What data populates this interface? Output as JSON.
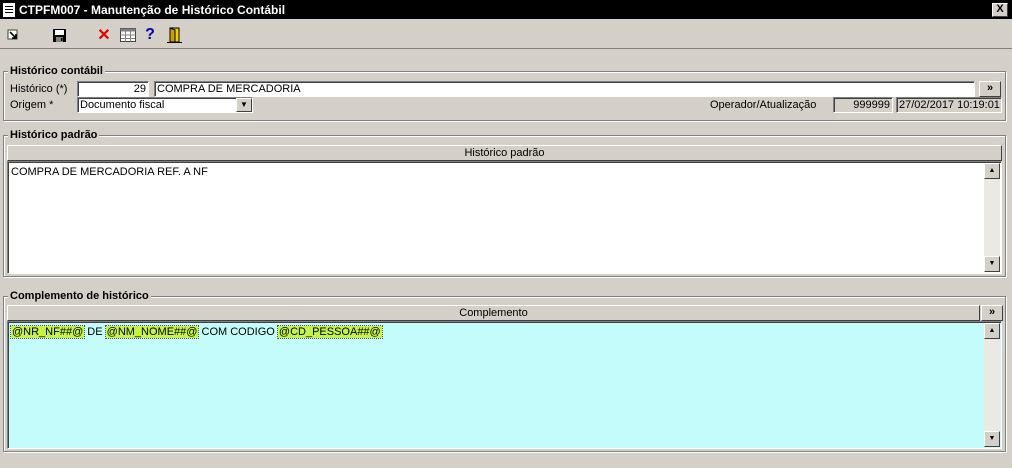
{
  "window": {
    "title": "CTPFM007 - Manutenção de Histórico Contábil",
    "close_label": "X"
  },
  "toolbar": {
    "buttons": [
      {
        "name": "exit-icon"
      },
      {
        "name": "save-icon"
      },
      {
        "name": "delete-icon",
        "glyph": "✕",
        "color": "#e00000"
      },
      {
        "name": "grid-icon"
      },
      {
        "name": "help-icon",
        "glyph": "?",
        "color": "#0000b0"
      },
      {
        "name": "door-icon"
      }
    ]
  },
  "historico_contabil": {
    "title": "Histórico contábil",
    "historico_label": "Histórico (*)",
    "historico_code": "29",
    "historico_desc": "COMPRA DE MERCADORIA",
    "expand_label": "»",
    "origem_label": "Origem *",
    "origem_value": "Documento fiscal",
    "operador_label": "Operador/Atualização",
    "operador_value": "999999",
    "atualizacao_value": "27/02/2017 10:19:01"
  },
  "historico_padrao": {
    "title": "Histórico padrão",
    "column_header": "Histórico padrão",
    "content": "COMPRA DE MERCADORIA REF. A NF"
  },
  "complemento": {
    "title": "Complemento de histórico",
    "column_header": "Complemento",
    "expand_label": "»",
    "tokens": [
      {
        "text": "@NR_NF##@",
        "highlight": true
      },
      {
        "text": " DE ",
        "highlight": false
      },
      {
        "text": "@NM_NOME##@",
        "highlight": true
      },
      {
        "text": " COM CODIGO ",
        "highlight": false
      },
      {
        "text": "@CD_PESSOA##@",
        "highlight": true
      }
    ]
  },
  "colors": {
    "background": "#d4d0c8",
    "complement_bg": "#c4fcfc",
    "highlight": "#c6f24a",
    "titlebar": "#000000"
  }
}
